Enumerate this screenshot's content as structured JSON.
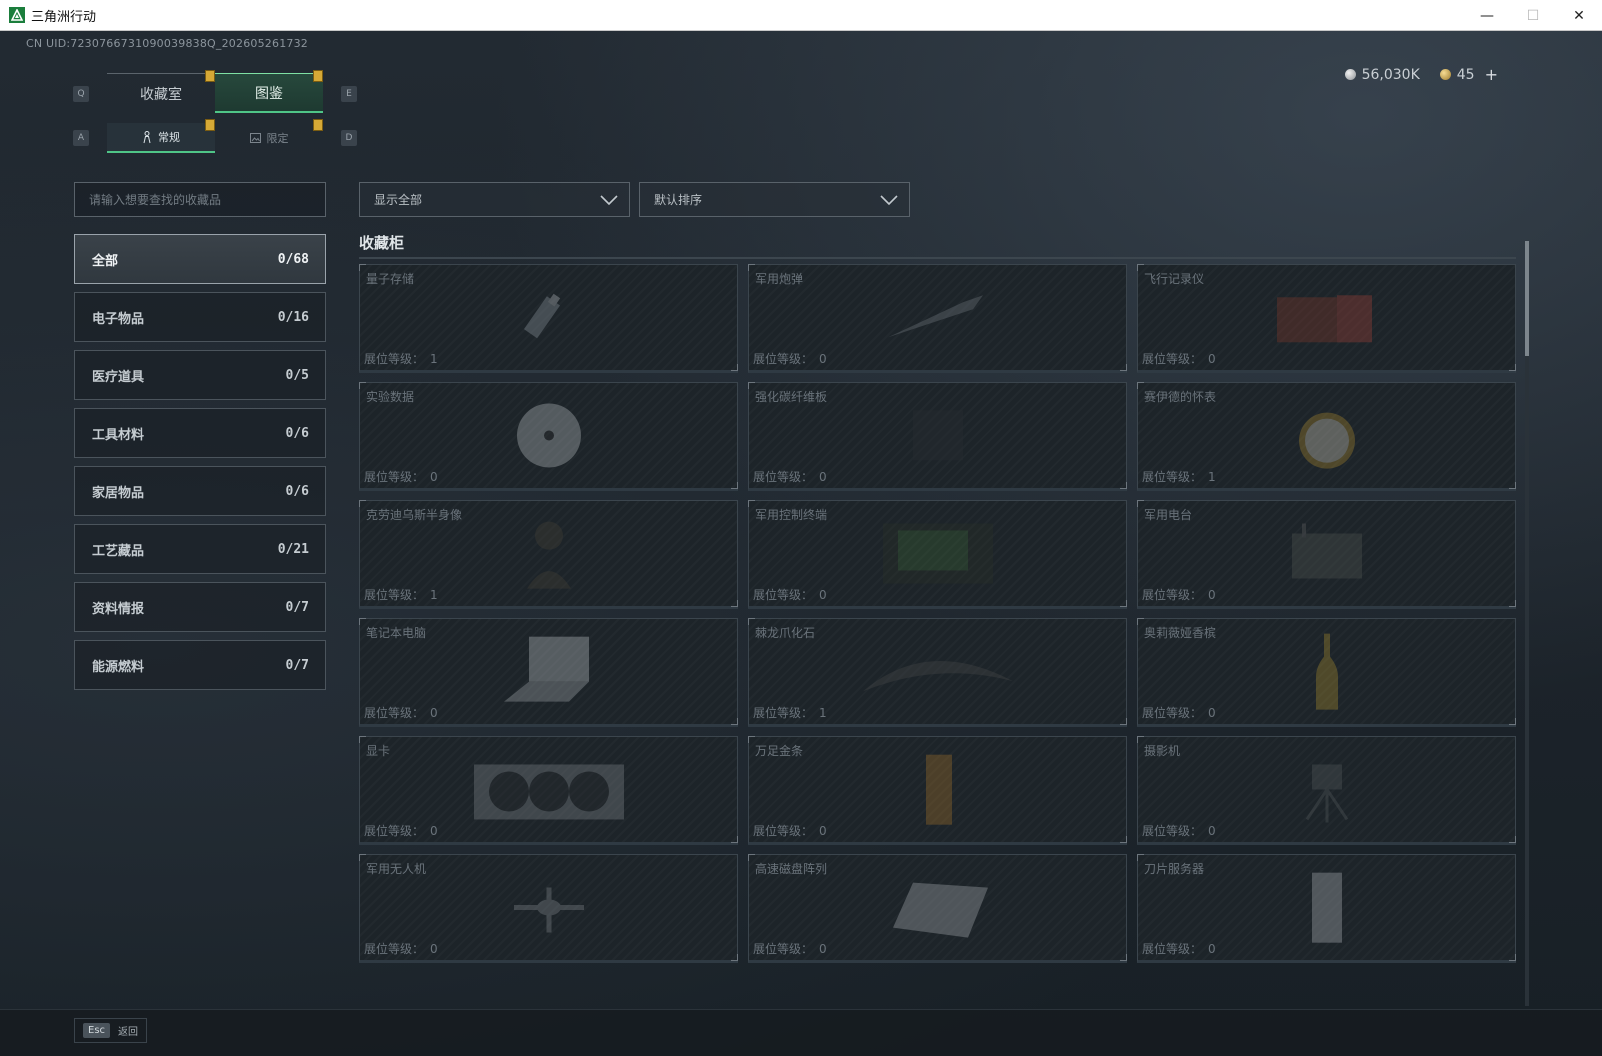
{
  "window": {
    "title": "三角洲行动",
    "controls": [
      "—",
      "☐",
      "✕"
    ]
  },
  "uid_line": "CN UID:7230766731090039838Q_202605261732",
  "currency": {
    "silver": "56,030K",
    "gold": "45",
    "add": "+"
  },
  "tabs_main": {
    "left_key": "Q",
    "right_key": "E",
    "items": [
      {
        "label": "收藏室"
      },
      {
        "label": "图鉴"
      }
    ]
  },
  "tabs_sub": {
    "left_key": "A",
    "right_key": "D",
    "items": [
      {
        "label": "常规"
      },
      {
        "label": "限定"
      }
    ]
  },
  "search": {
    "placeholder": "请输入想要查找的收藏品"
  },
  "filters": {
    "display": "显示全部",
    "sort": "默认排序"
  },
  "categories": [
    {
      "label": "全部",
      "count": "0/68"
    },
    {
      "label": "电子物品",
      "count": "0/16"
    },
    {
      "label": "医疗道具",
      "count": "0/5"
    },
    {
      "label": "工具材料",
      "count": "0/6"
    },
    {
      "label": "家居物品",
      "count": "0/6"
    },
    {
      "label": "工艺藏品",
      "count": "0/21"
    },
    {
      "label": "资料情报",
      "count": "0/7"
    },
    {
      "label": "能源燃料",
      "count": "0/7"
    }
  ],
  "section_title": "收藏柜",
  "level_label": "展位等级：",
  "items": [
    {
      "name": "量子存储",
      "level": "1",
      "icon": "usb-drive-icon"
    },
    {
      "name": "军用炮弹",
      "level": "0",
      "icon": "artillery-shell-icon"
    },
    {
      "name": "飞行记录仪",
      "level": "0",
      "icon": "flight-recorder-icon"
    },
    {
      "name": "实验数据",
      "level": "0",
      "icon": "disc-icon"
    },
    {
      "name": "强化碳纤维板",
      "level": "0",
      "icon": "carbon-plate-icon"
    },
    {
      "name": "赛伊德的怀表",
      "level": "1",
      "icon": "pocket-watch-icon"
    },
    {
      "name": "克劳迪乌斯半身像",
      "level": "1",
      "icon": "bust-statue-icon"
    },
    {
      "name": "军用控制终端",
      "level": "0",
      "icon": "control-terminal-icon"
    },
    {
      "name": "军用电台",
      "level": "0",
      "icon": "military-radio-icon"
    },
    {
      "name": "笔记本电脑",
      "level": "0",
      "icon": "laptop-icon"
    },
    {
      "name": "棘龙爪化石",
      "level": "1",
      "icon": "claw-fossil-icon"
    },
    {
      "name": "奥莉薇娅香槟",
      "level": "0",
      "icon": "champagne-bottle-icon"
    },
    {
      "name": "显卡",
      "level": "0",
      "icon": "graphics-card-icon"
    },
    {
      "name": "万足金条",
      "level": "0",
      "icon": "gold-bar-icon"
    },
    {
      "name": "摄影机",
      "level": "0",
      "icon": "camera-icon"
    },
    {
      "name": "军用无人机",
      "level": "0",
      "icon": "drone-icon"
    },
    {
      "name": "高速磁盘阵列",
      "level": "0",
      "icon": "disk-array-icon"
    },
    {
      "name": "刀片服务器",
      "level": "0",
      "icon": "blade-server-icon"
    }
  ],
  "bottom": {
    "esc_key": "Esc",
    "esc_label": "返回"
  }
}
